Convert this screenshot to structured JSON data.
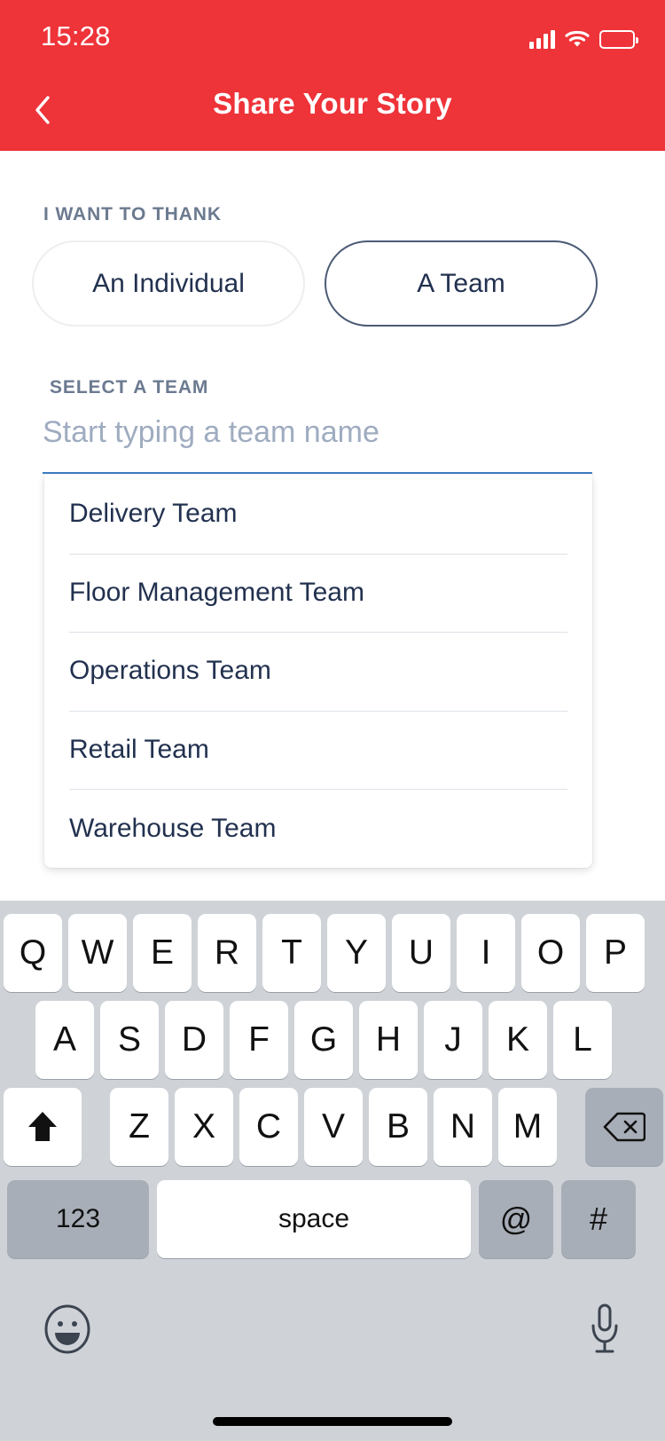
{
  "status_bar": {
    "time": "15:28",
    "signal_icon": "signal-bars-icon",
    "wifi_icon": "wifi-icon",
    "battery_icon": "battery-full-icon"
  },
  "header": {
    "title": "Share Your Story",
    "back_icon": "chevron-left-icon",
    "background_color": "#EE3339",
    "text_color": "#FFFFFF"
  },
  "form": {
    "thank_section": {
      "label": "I WANT TO THANK",
      "options": [
        {
          "label": "An Individual",
          "selected": false
        },
        {
          "label": "A Team",
          "selected": true
        }
      ]
    },
    "team_section": {
      "label": "SELECT A TEAM",
      "input_value": "",
      "input_placeholder": "Start typing a team name",
      "underline_color": "#3D7EC0"
    },
    "dropdown": {
      "items": [
        "Delivery Team",
        "Floor Management Team",
        "Operations Team",
        "Retail Team",
        "Warehouse Team"
      ]
    }
  },
  "keyboard": {
    "row1": [
      "Q",
      "W",
      "E",
      "R",
      "T",
      "Y",
      "U",
      "I",
      "O",
      "P"
    ],
    "row2": [
      "A",
      "S",
      "D",
      "F",
      "G",
      "H",
      "J",
      "K",
      "L"
    ],
    "row3": [
      "Z",
      "X",
      "C",
      "V",
      "B",
      "N",
      "M"
    ],
    "shift_icon": "shift-up-arrow-icon",
    "delete_icon": "backspace-delete-icon",
    "numeric_key": "123",
    "space_key": "space",
    "at_key": "@",
    "hash_key": "#",
    "emoji_icon": "emoji-smiley-icon",
    "mic_icon": "microphone-icon",
    "background_color": "#CFD3D8"
  }
}
